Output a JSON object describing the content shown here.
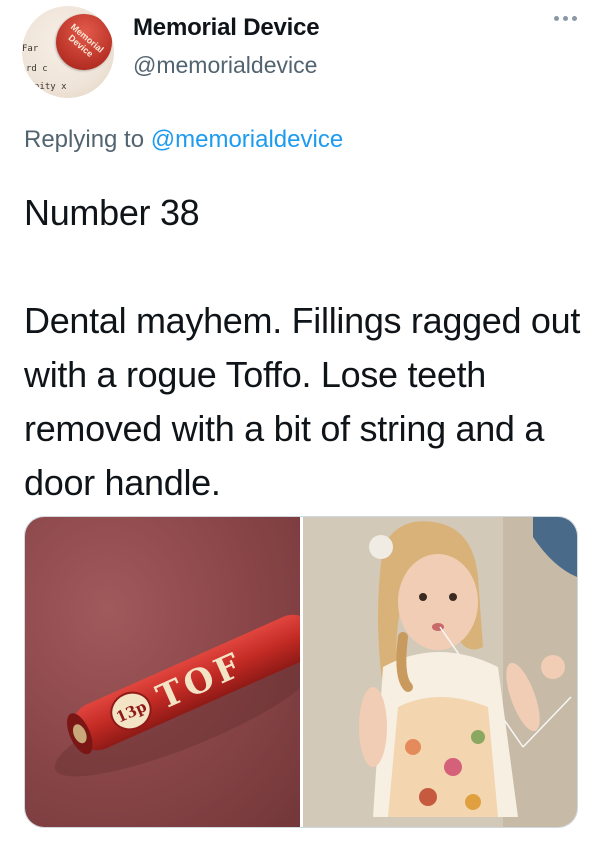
{
  "tweet": {
    "display_name": "Memorial Device",
    "handle": "@memorialdevice",
    "replying_prefix": "Replying to ",
    "replying_to": "@memorialdevice",
    "text_line1": "Number 38",
    "text_paragraph2": "Dental mayhem. Fillings ragged out with a rogue Toffo. Lose teeth removed with a bit of string and a door handle."
  },
  "avatar": {
    "badge_line1": "Memorial",
    "badge_line2": "Device",
    "scrap_top": "Far",
    "scrap_mid": "rd c",
    "scrap_bottom": "nity x"
  },
  "media": {
    "left_photo": {
      "wrapper_price": "13p",
      "wrapper_text": "TOF"
    }
  },
  "colors": {
    "accent": "#1d9bf0",
    "secondary_text": "#536471",
    "primary_text": "#0f1419"
  },
  "icons": {
    "more": "more-horizontal-icon"
  }
}
